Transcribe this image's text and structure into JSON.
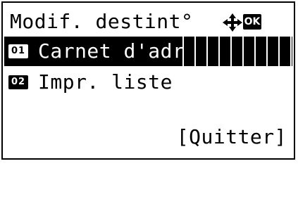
{
  "screen": {
    "title": "Modif. destint°",
    "nav_icon": "four-way-arrow-icon",
    "ok_label": "OK"
  },
  "menu": {
    "items": [
      {
        "number": "01",
        "label": "Carnet d'adr",
        "selected": true
      },
      {
        "number": "02",
        "label": "Impr. liste",
        "selected": false
      }
    ]
  },
  "softkeys": {
    "right": "[Quitter]"
  }
}
